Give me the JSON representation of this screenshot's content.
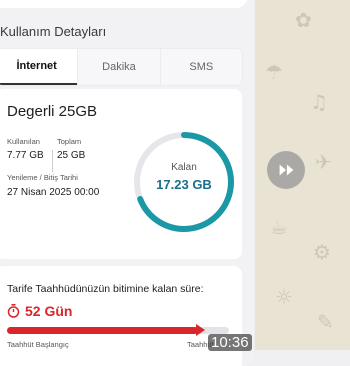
{
  "header": {
    "section_title": "Kullanım Detayları"
  },
  "tabs": [
    {
      "label": "İnternet",
      "active": true
    },
    {
      "label": "Dakika",
      "active": false
    },
    {
      "label": "SMS",
      "active": false
    }
  ],
  "usage": {
    "plan_name": "Degerli 25GB",
    "used_label": "Kullanılan",
    "used_value": "7.77 GB",
    "total_label": "Toplam",
    "total_value": "25 GB",
    "renewal_label": "Yenileme / Bitiş Tarihi",
    "renewal_value": "27 Nisan 2025 00:00",
    "remaining_label": "Kalan",
    "remaining_value": "17.23 GB",
    "remaining_fraction": 0.69,
    "ring_color": "#1a98a6"
  },
  "commitment": {
    "title": "Tarife Taahhüdünüzün bitimine kalan süre:",
    "days_remaining": "52 Gün",
    "elapsed_fraction": 0.86,
    "start_label": "Taahhüt Başlangıç",
    "end_label": "Taahhüt"
  },
  "overlay": {
    "time": "10:36",
    "share_icon": "forward-arrow-icon"
  },
  "colors": {
    "accent_red": "#d9262b",
    "ring_teal": "#1a98a6"
  }
}
